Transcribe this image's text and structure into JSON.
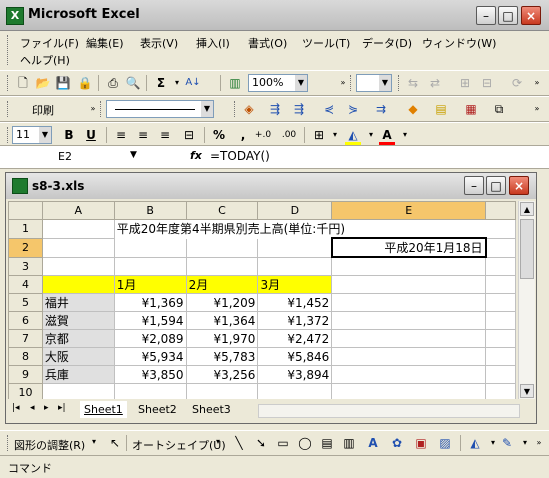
{
  "app": {
    "title": "Microsoft Excel",
    "icon_letter": "X"
  },
  "menu": {
    "row1": [
      "ファイル(F)",
      "編集(E)",
      "表示(V)",
      "挿入(I)",
      "書式(O)",
      "ツール(T)",
      "データ(D)",
      "ウィンドウ(W)"
    ],
    "row2": [
      "ヘルプ(H)"
    ]
  },
  "toolbar": {
    "zoom": "100%",
    "print_label": "印刷",
    "font_size": "11",
    "bold": "B",
    "underline": "U",
    "percent": "%",
    "comma": ","
  },
  "formula_bar": {
    "name_box": "E2",
    "fx": "fx",
    "formula": "=TODAY()"
  },
  "workbook": {
    "title": "s8-3.xls",
    "columns": [
      "A",
      "B",
      "C",
      "D",
      "E"
    ],
    "row_numbers": [
      "1",
      "2",
      "3",
      "4",
      "5",
      "6",
      "7",
      "8",
      "9",
      "10"
    ],
    "title_text": "平成20年度第4半期県別売上高(単位:千円)",
    "date_text": "平成20年1月18日",
    "headers": [
      "1月",
      "2月",
      "3月"
    ],
    "rows": [
      {
        "name": "福井",
        "values": [
          "¥1,369",
          "¥1,209",
          "¥1,452"
        ]
      },
      {
        "name": "滋賀",
        "values": [
          "¥1,594",
          "¥1,364",
          "¥1,372"
        ]
      },
      {
        "name": "京都",
        "values": [
          "¥2,089",
          "¥1,970",
          "¥2,472"
        ]
      },
      {
        "name": "大阪",
        "values": [
          "¥5,934",
          "¥5,783",
          "¥5,846"
        ]
      },
      {
        "name": "兵庫",
        "values": [
          "¥3,850",
          "¥3,256",
          "¥3,894"
        ]
      }
    ],
    "sheets": [
      "Sheet1",
      "Sheet2",
      "Sheet3"
    ]
  },
  "drawbar": {
    "adjust": "図形の調整(R)",
    "autoshape": "オートシェイプ(U)"
  },
  "status": {
    "text": "コマンド"
  },
  "colors": {
    "header_fill": "#ffff00",
    "selected_header": "#f5c66b",
    "font_color_bar": "#ff0000"
  }
}
